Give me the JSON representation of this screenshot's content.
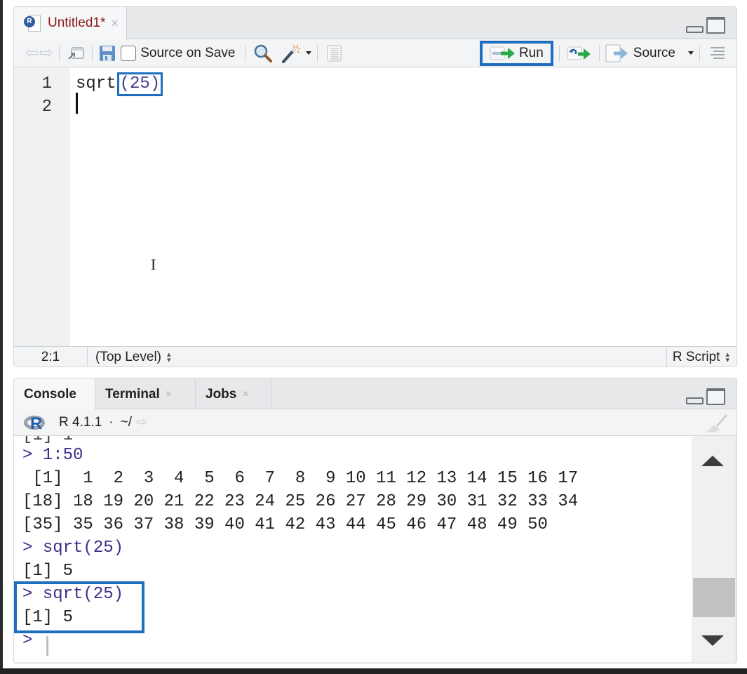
{
  "editor": {
    "tab": {
      "label": "Untitled1*",
      "icon": "r-script-file-icon",
      "close": "×"
    },
    "toolbar": {
      "back_icon": "⇦",
      "forward_icon": "⇨",
      "source_on_save_label": "Source on Save",
      "source_on_save_checked": false,
      "run_label": "Run",
      "source_label": "Source"
    },
    "lines": [
      {
        "number": "1",
        "func": "sqrt",
        "arg": "(25)"
      },
      {
        "number": "2",
        "func": "",
        "arg": ""
      }
    ],
    "cursor_glyph": "I",
    "status": {
      "position": "2:1",
      "scope": "(Top Level)",
      "file_type": "R Script",
      "updown": "⬍"
    }
  },
  "console": {
    "tabs": [
      {
        "label": "Console",
        "active": true
      },
      {
        "label": "Terminal",
        "close": "×"
      },
      {
        "label": "Jobs",
        "close": "×"
      }
    ],
    "header": {
      "version": "R 4.1.1",
      "separator": "·",
      "path": "~/",
      "goto_icon": "⇨"
    },
    "output": [
      {
        "type": "cmd",
        "prompt": ">",
        "text": "1:50"
      },
      {
        "type": "out",
        "text": " [1]  1  2  3  4  5  6  7  8  9 10 11 12 13 14 15 16 17"
      },
      {
        "type": "out",
        "text": "[18] 18 19 20 21 22 23 24 25 26 27 28 29 30 31 32 33 34"
      },
      {
        "type": "out",
        "text": "[35] 35 36 37 38 39 40 41 42 43 44 45 46 47 48 49 50"
      },
      {
        "type": "cmd",
        "prompt": ">",
        "text": "sqrt(25)"
      },
      {
        "type": "out",
        "text": "[1] 5"
      },
      {
        "type": "cmd",
        "prompt": ">",
        "text": "sqrt(25)"
      },
      {
        "type": "out",
        "text": "[1] 5"
      },
      {
        "type": "cmd",
        "prompt": ">",
        "text": ""
      }
    ],
    "scroll_position_fraction": 0.85
  },
  "colors": {
    "highlight": "#1f6fc0",
    "tab_title": "#8b1a1a",
    "console_command": "#3a2f8a"
  }
}
